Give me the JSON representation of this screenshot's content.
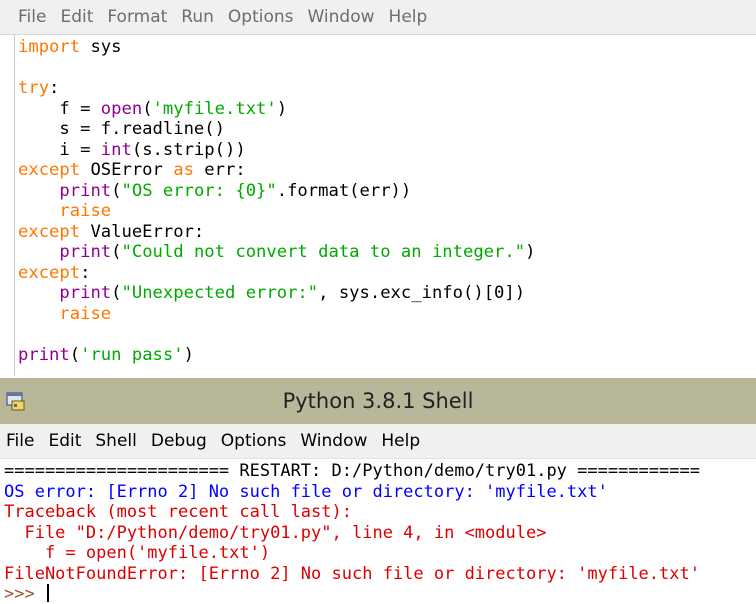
{
  "editor": {
    "menu": [
      "File",
      "Edit",
      "Format",
      "Run",
      "Options",
      "Window",
      "Help"
    ],
    "code": [
      [
        {
          "t": "import",
          "c": "kw"
        },
        {
          "t": " sys",
          "c": ""
        }
      ],
      [],
      [
        {
          "t": "try",
          "c": "kw"
        },
        {
          "t": ":",
          "c": ""
        }
      ],
      [
        {
          "t": "    f = ",
          "c": ""
        },
        {
          "t": "open",
          "c": "bi"
        },
        {
          "t": "(",
          "c": ""
        },
        {
          "t": "'myfile.txt'",
          "c": "str"
        },
        {
          "t": ")",
          "c": ""
        }
      ],
      [
        {
          "t": "    s = f.readline()",
          "c": ""
        }
      ],
      [
        {
          "t": "    i = ",
          "c": ""
        },
        {
          "t": "int",
          "c": "bi"
        },
        {
          "t": "(s.strip())",
          "c": ""
        }
      ],
      [
        {
          "t": "except",
          "c": "kw"
        },
        {
          "t": " OSError ",
          "c": ""
        },
        {
          "t": "as",
          "c": "kw"
        },
        {
          "t": " err:",
          "c": ""
        }
      ],
      [
        {
          "t": "    ",
          "c": ""
        },
        {
          "t": "print",
          "c": "bi"
        },
        {
          "t": "(",
          "c": ""
        },
        {
          "t": "\"OS error: {0}\"",
          "c": "str"
        },
        {
          "t": ".format(err))",
          "c": ""
        }
      ],
      [
        {
          "t": "    ",
          "c": ""
        },
        {
          "t": "raise",
          "c": "kw"
        }
      ],
      [
        {
          "t": "except",
          "c": "kw"
        },
        {
          "t": " ValueError:",
          "c": ""
        }
      ],
      [
        {
          "t": "    ",
          "c": ""
        },
        {
          "t": "print",
          "c": "bi"
        },
        {
          "t": "(",
          "c": ""
        },
        {
          "t": "\"Could not convert data to an integer.\"",
          "c": "str"
        },
        {
          "t": ")",
          "c": ""
        }
      ],
      [
        {
          "t": "except",
          "c": "kw"
        },
        {
          "t": ":",
          "c": ""
        }
      ],
      [
        {
          "t": "    ",
          "c": ""
        },
        {
          "t": "print",
          "c": "bi"
        },
        {
          "t": "(",
          "c": ""
        },
        {
          "t": "\"Unexpected error:\"",
          "c": "str"
        },
        {
          "t": ", sys.exc_info()[0])",
          "c": ""
        }
      ],
      [
        {
          "t": "    ",
          "c": ""
        },
        {
          "t": "raise",
          "c": "kw"
        }
      ],
      [],
      [
        {
          "t": "print",
          "c": "bi"
        },
        {
          "t": "(",
          "c": ""
        },
        {
          "t": "'run pass'",
          "c": "str"
        },
        {
          "t": ")",
          "c": ""
        }
      ]
    ]
  },
  "shell": {
    "title": "Python 3.8.1 Shell",
    "app_icon": "python-idle-icon",
    "menu": [
      "File",
      "Edit",
      "Shell",
      "Debug",
      "Options",
      "Window",
      "Help"
    ],
    "output": [
      {
        "t": "====================== RESTART: D:/Python/demo/try01.py ============",
        "c": "blk"
      },
      {
        "t": "OS error: [Errno 2] No such file or directory: 'myfile.txt'",
        "c": "blue"
      },
      {
        "t": "Traceback (most recent call last):",
        "c": "red"
      },
      {
        "t": "  File \"D:/Python/demo/try01.py\", line 4, in <module>",
        "c": "red"
      },
      {
        "t": "    f = open('myfile.txt')",
        "c": "red"
      },
      {
        "t": "FileNotFoundError: [Errno 2] No such file or directory: 'myfile.txt'",
        "c": "red"
      }
    ],
    "prompt": ">>> "
  },
  "colors": {
    "keyword": "#ff7700",
    "builtin": "#900090",
    "string": "#00aa00",
    "stdout": "#0000ff",
    "stderr": "#dd0000",
    "titlebar": "#b8b79a"
  }
}
